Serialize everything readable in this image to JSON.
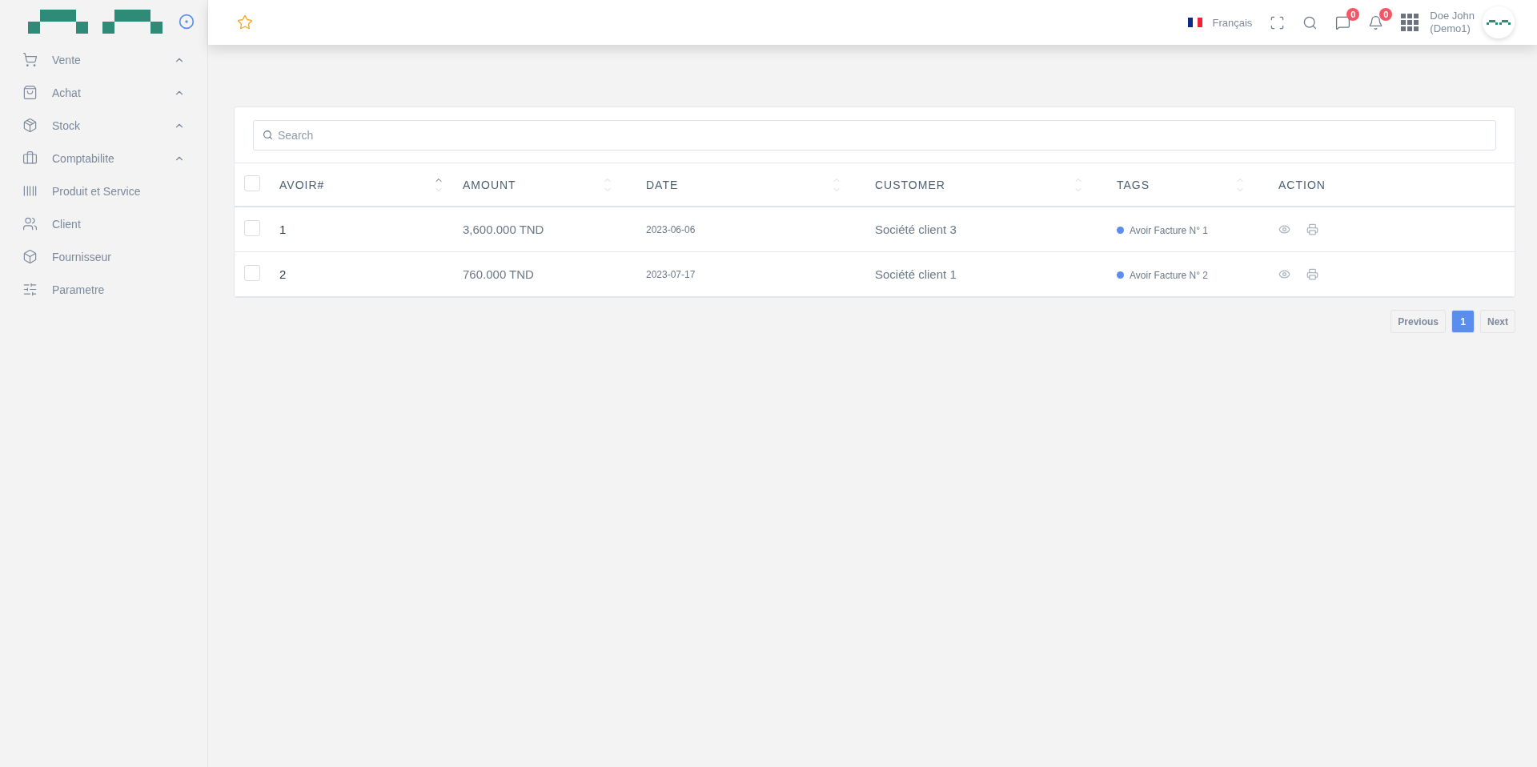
{
  "sidebar": {
    "items": [
      {
        "kind": "cart",
        "label": "Vente",
        "expandable": true
      },
      {
        "kind": "bag",
        "label": "Achat",
        "expandable": true
      },
      {
        "kind": "package",
        "label": "Stock",
        "expandable": true
      },
      {
        "kind": "briefcase",
        "label": "Comptabilite",
        "expandable": true
      },
      {
        "kind": "barcode",
        "label": "Produit et Service",
        "expandable": false
      },
      {
        "kind": "users",
        "label": "Client",
        "expandable": false
      },
      {
        "kind": "box",
        "label": "Fournisseur",
        "expandable": false
      },
      {
        "kind": "sliders",
        "label": "Parametre",
        "expandable": false
      }
    ]
  },
  "header": {
    "language": "Français",
    "messages_count": "0",
    "notifications_count": "0",
    "user_name": "Doe John",
    "user_role": "(Demo1)"
  },
  "search": {
    "placeholder": "Search"
  },
  "table": {
    "all_checked": false,
    "columns": [
      {
        "label": "AVOIR#",
        "sortable": true,
        "sorted_ascending": true
      },
      {
        "label": "AMOUNT",
        "sortable": true,
        "sorted_ascending": false
      },
      {
        "label": "DATE",
        "sortable": true,
        "sorted_ascending": false
      },
      {
        "label": "CUSTOMER",
        "sortable": true,
        "sorted_ascending": false
      },
      {
        "label": "TAGS",
        "sortable": true,
        "sorted_ascending": false
      },
      {
        "label": "ACTION",
        "sortable": false
      }
    ],
    "rows": [
      {
        "checked": false,
        "number": "1",
        "amount": "3,600.000 TND",
        "date": "2023-06-06",
        "customer": "Société client 3",
        "tag": {
          "label": "Avoir Facture N° 1",
          "color": "#5b8def"
        }
      },
      {
        "checked": false,
        "number": "2",
        "amount": "760.000 TND",
        "date": "2023-07-17",
        "customer": "Société client 1",
        "tag": {
          "label": "Avoir Facture N° 2",
          "color": "#5b8def"
        }
      }
    ]
  },
  "pagination": {
    "previous": "Previous",
    "pages": [
      {
        "label": "1",
        "selected": true
      }
    ],
    "next": "Next"
  }
}
